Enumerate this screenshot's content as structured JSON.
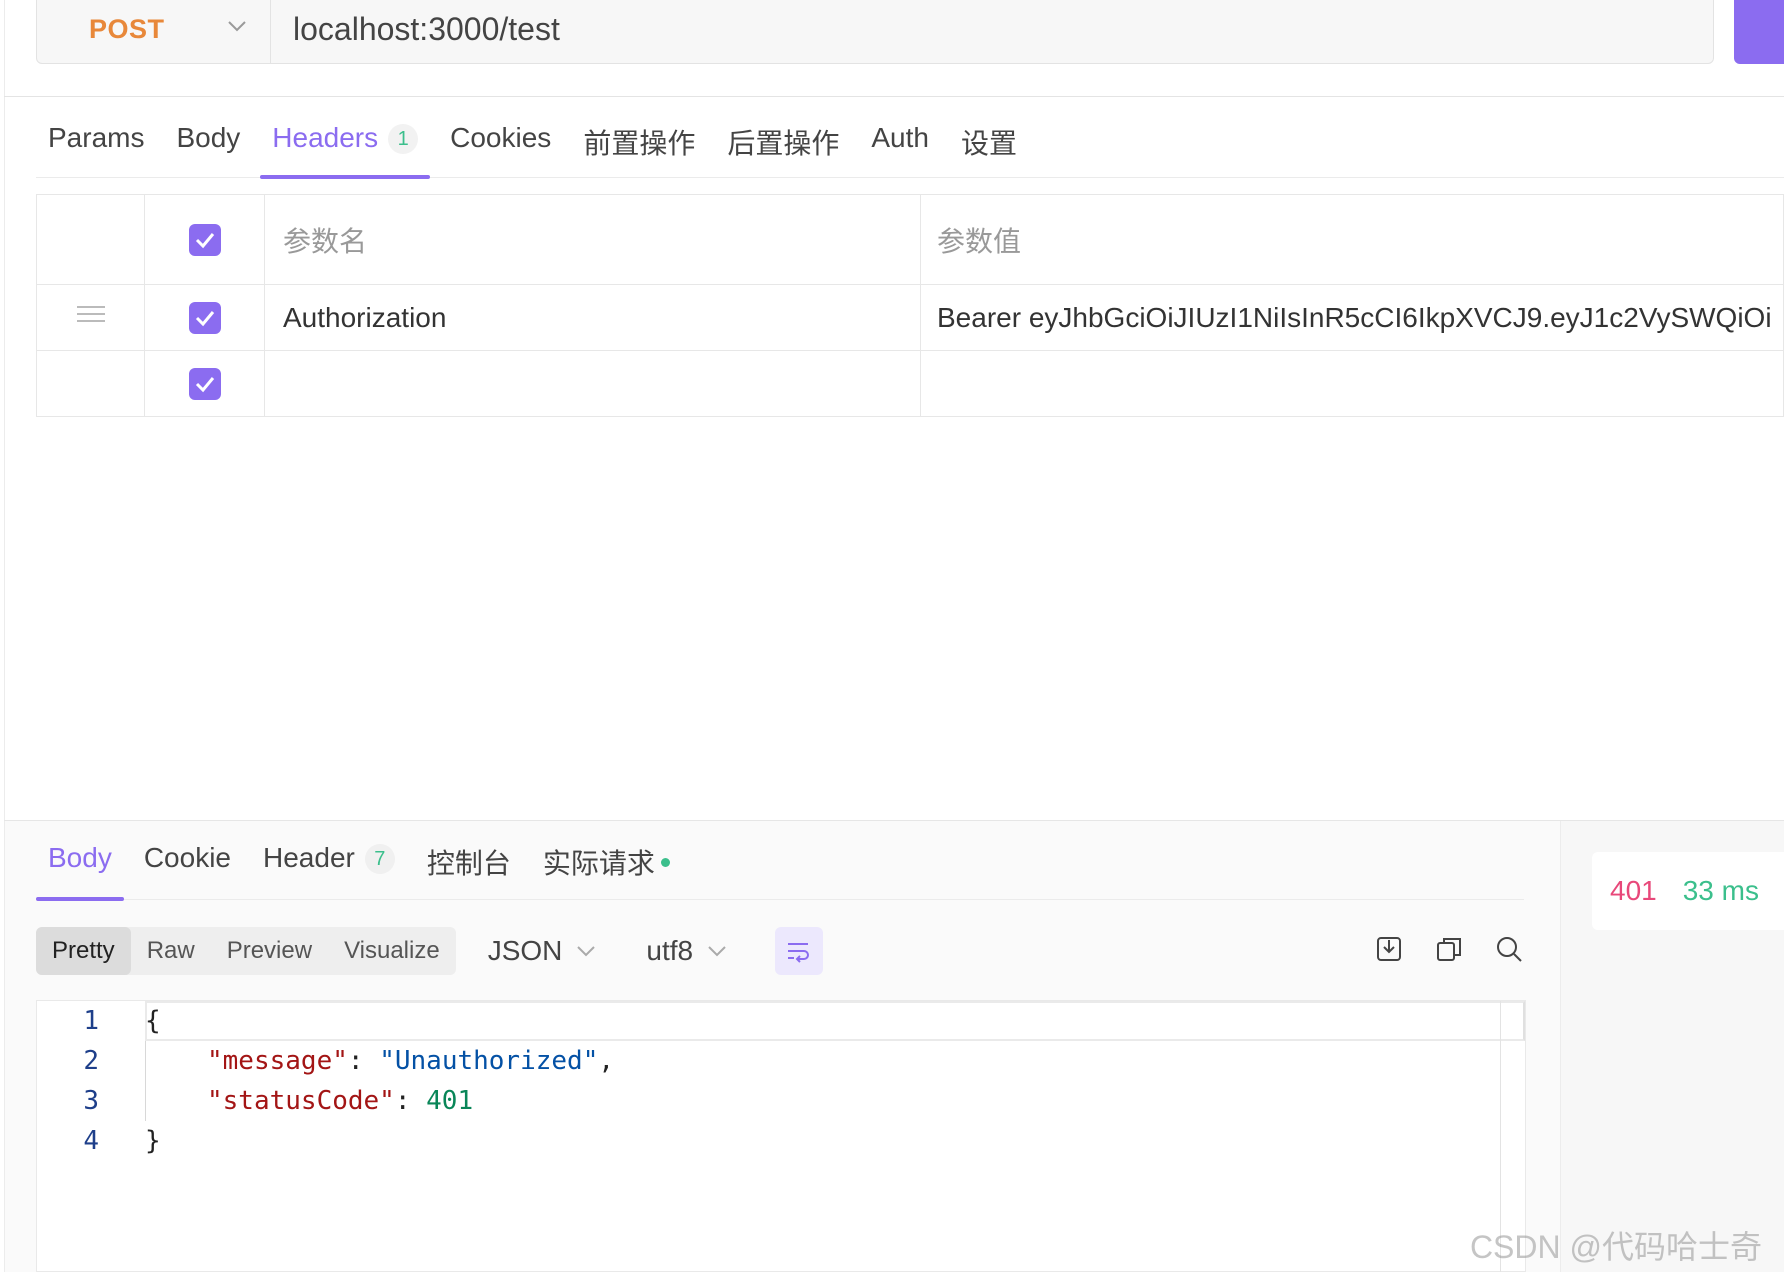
{
  "request": {
    "method": "POST",
    "url": "localhost:3000/test"
  },
  "request_tabs": [
    {
      "label": "Params"
    },
    {
      "label": "Body"
    },
    {
      "label": "Headers",
      "badge": "1",
      "active": true
    },
    {
      "label": "Cookies"
    },
    {
      "label": "前置操作"
    },
    {
      "label": "后置操作"
    },
    {
      "label": "Auth"
    },
    {
      "label": "设置"
    }
  ],
  "headers_table": {
    "col_name": "参数名",
    "col_value": "参数值",
    "rows": [
      {
        "name": "Authorization",
        "value": "Bearer eyJhbGciOiJIUzI1NiIsInR5cCI6IkpXVCJ9.eyJ1c2VySWQiOi",
        "checked": true
      },
      {
        "name": "",
        "value": "",
        "checked": true
      }
    ]
  },
  "response_tabs": [
    {
      "label": "Body",
      "active": true
    },
    {
      "label": "Cookie"
    },
    {
      "label": "Header",
      "badge": "7"
    },
    {
      "label": "控制台"
    },
    {
      "label": "实际请求",
      "dot": true
    }
  ],
  "response_toolbar": {
    "view_modes": [
      "Pretty",
      "Raw",
      "Preview",
      "Visualize"
    ],
    "active_view": "Pretty",
    "format": "JSON",
    "encoding": "utf8"
  },
  "status": {
    "code": "401",
    "time": "33 ms"
  },
  "response_body": {
    "line_numbers": [
      "1",
      "2",
      "3",
      "4"
    ],
    "open_brace": "{",
    "close_brace": "}",
    "message_key": "\"message\"",
    "message_value": "\"Unauthorized\"",
    "status_key": "\"statusCode\"",
    "status_value": "401"
  },
  "watermark": "CSDN @代码哈士奇",
  "colors": {
    "accent": "#8b6cf0",
    "method": "#e8883a",
    "status_error": "#e8487a",
    "status_ok": "#3bbf8c"
  }
}
